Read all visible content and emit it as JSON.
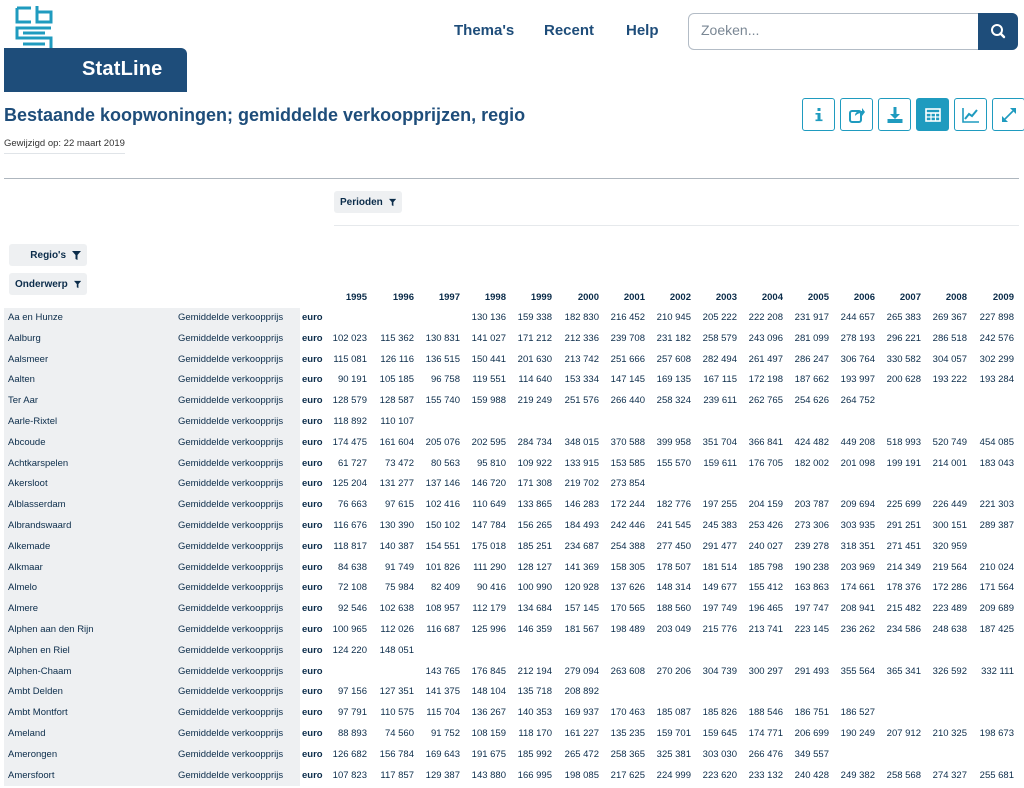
{
  "brand": {
    "name": "StatLine"
  },
  "nav": {
    "items": [
      "Thema's",
      "Recent",
      "Help"
    ]
  },
  "search": {
    "placeholder": "Zoeken..."
  },
  "page": {
    "title": "Bestaande koopwoningen; gemiddelde verkoopprijzen, regio",
    "modified": "Gewijzigd op: 22 maart 2019"
  },
  "toolbar": {
    "buttons": [
      "info-icon",
      "share-icon",
      "download-icon",
      "table-icon",
      "chart-icon",
      "fullscreen-icon"
    ],
    "accent": "#1f9bbf",
    "active": "table-icon"
  },
  "filters": {
    "periods": "Perioden",
    "regions": "Regio's",
    "subject": "Onderwerp"
  },
  "colors": {
    "brand": "#1e4d7a",
    "accent": "#1f9bbf"
  },
  "table": {
    "subject": "Gemiddelde verkoopprijs",
    "unit": "euro",
    "years": [
      "1995",
      "1996",
      "1997",
      "1998",
      "1999",
      "2000",
      "2001",
      "2002",
      "2003",
      "2004",
      "2005",
      "2006",
      "2007",
      "2008",
      "2009"
    ],
    "rows": [
      {
        "region": "Aa en Hunze",
        "values": [
          "",
          "",
          "",
          "130 136",
          "159 338",
          "182 830",
          "216 452",
          "210 945",
          "205 222",
          "222 208",
          "231 917",
          "244 657",
          "265 383",
          "269 367",
          "227 898"
        ]
      },
      {
        "region": "Aalburg",
        "values": [
          "102 023",
          "115 362",
          "130 831",
          "141 027",
          "171 212",
          "212 336",
          "239 708",
          "231 182",
          "258 579",
          "243 096",
          "281 099",
          "278 193",
          "296 221",
          "286 518",
          "242 576"
        ]
      },
      {
        "region": "Aalsmeer",
        "values": [
          "115 081",
          "126 116",
          "136 515",
          "150 441",
          "201 630",
          "213 742",
          "251 666",
          "257 608",
          "282 494",
          "261 497",
          "286 247",
          "306 764",
          "330 582",
          "304 057",
          "302 299"
        ]
      },
      {
        "region": "Aalten",
        "values": [
          "90 191",
          "105 185",
          "96 758",
          "119 551",
          "114 640",
          "153 334",
          "147 145",
          "169 135",
          "167 115",
          "172 198",
          "187 662",
          "193 997",
          "200 628",
          "193 222",
          "193 284"
        ]
      },
      {
        "region": "Ter Aar",
        "values": [
          "128 579",
          "128 587",
          "155 740",
          "159 988",
          "219 249",
          "251 576",
          "266 440",
          "258 324",
          "239 611",
          "262 765",
          "254 626",
          "264 752",
          "",
          "",
          ""
        ]
      },
      {
        "region": "Aarle-Rixtel",
        "values": [
          "118 892",
          "110 107",
          "",
          "",
          "",
          "",
          "",
          "",
          "",
          "",
          "",
          "",
          "",
          "",
          ""
        ]
      },
      {
        "region": "Abcoude",
        "values": [
          "174 475",
          "161 604",
          "205 076",
          "202 595",
          "284 734",
          "348 015",
          "370 588",
          "399 958",
          "351 704",
          "366 841",
          "424 482",
          "449 208",
          "518 993",
          "520 749",
          "454 085"
        ]
      },
      {
        "region": "Achtkarspelen",
        "values": [
          "61 727",
          "73 472",
          "80 563",
          "95 810",
          "109 922",
          "133 915",
          "153 585",
          "155 570",
          "159 611",
          "176 705",
          "182 002",
          "201 098",
          "199 191",
          "214 001",
          "183 043"
        ]
      },
      {
        "region": "Akersloot",
        "values": [
          "125 204",
          "131 277",
          "137 146",
          "146 720",
          "171 308",
          "219 702",
          "273 854",
          "",
          "",
          "",
          "",
          "",
          "",
          "",
          ""
        ]
      },
      {
        "region": "Alblasserdam",
        "values": [
          "76 663",
          "97 615",
          "102 416",
          "110 649",
          "133 865",
          "146 283",
          "172 244",
          "182 776",
          "197 255",
          "204 159",
          "203 787",
          "209 694",
          "225 699",
          "226 449",
          "221 303"
        ]
      },
      {
        "region": "Albrandswaard",
        "values": [
          "116 676",
          "130 390",
          "150 102",
          "147 784",
          "156 265",
          "184 493",
          "242 446",
          "241 545",
          "245 383",
          "253 426",
          "273 306",
          "303 935",
          "291 251",
          "300 151",
          "289 387"
        ]
      },
      {
        "region": "Alkemade",
        "values": [
          "118 817",
          "140 387",
          "154 551",
          "175 018",
          "185 251",
          "234 687",
          "254 388",
          "277 450",
          "291 477",
          "240 027",
          "239 278",
          "318 351",
          "271 451",
          "320 959",
          ""
        ]
      },
      {
        "region": "Alkmaar",
        "values": [
          "84 638",
          "91 749",
          "101 826",
          "111 290",
          "128 127",
          "141 369",
          "158 305",
          "178 507",
          "181 514",
          "185 798",
          "190 238",
          "203 969",
          "214 349",
          "219 564",
          "210 024"
        ]
      },
      {
        "region": "Almelo",
        "values": [
          "72 108",
          "75 984",
          "82 409",
          "90 416",
          "100 990",
          "120 928",
          "137 626",
          "148 314",
          "149 677",
          "155 412",
          "163 863",
          "174 661",
          "178 376",
          "172 286",
          "171 564"
        ]
      },
      {
        "region": "Almere",
        "values": [
          "92 546",
          "102 638",
          "108 957",
          "112 179",
          "134 684",
          "157 145",
          "170 565",
          "188 560",
          "197 749",
          "196 465",
          "197 747",
          "208 941",
          "215 482",
          "223 489",
          "209 689"
        ]
      },
      {
        "region": "Alphen aan den Rijn",
        "values": [
          "100 965",
          "112 026",
          "116 687",
          "125 996",
          "146 359",
          "181 567",
          "198 489",
          "203 049",
          "215 776",
          "213 741",
          "223 145",
          "236 262",
          "234 586",
          "248 638",
          "187 425"
        ]
      },
      {
        "region": "Alphen en Riel",
        "values": [
          "124 220",
          "148 051",
          "",
          "",
          "",
          "",
          "",
          "",
          "",
          "",
          "",
          "",
          "",
          "",
          ""
        ]
      },
      {
        "region": "Alphen-Chaam",
        "values": [
          "",
          "",
          "143 765",
          "176 845",
          "212 194",
          "279 094",
          "263 608",
          "270 206",
          "304 739",
          "300 297",
          "291 493",
          "355 564",
          "365 341",
          "326 592",
          "332 111"
        ]
      },
      {
        "region": "Ambt Delden",
        "values": [
          "97 156",
          "127 351",
          "141 375",
          "148 104",
          "135 718",
          "208 892",
          "",
          "",
          "",
          "",
          "",
          "",
          "",
          "",
          ""
        ]
      },
      {
        "region": "Ambt Montfort",
        "values": [
          "97 791",
          "110 575",
          "115 704",
          "136 267",
          "140 353",
          "169 937",
          "170 463",
          "185 087",
          "185 826",
          "188 546",
          "186 751",
          "186 527",
          "",
          "",
          ""
        ]
      },
      {
        "region": "Ameland",
        "values": [
          "88 893",
          "74 560",
          "91 752",
          "108 159",
          "118 170",
          "161 227",
          "135 235",
          "159 701",
          "159 645",
          "174 771",
          "206 699",
          "190 249",
          "207 912",
          "210 325",
          "198 673"
        ]
      },
      {
        "region": "Amerongen",
        "values": [
          "126 682",
          "156 784",
          "169 643",
          "191 675",
          "185 992",
          "265 472",
          "258 365",
          "325 381",
          "303 030",
          "266 476",
          "349 557",
          "",
          "",
          "",
          ""
        ]
      },
      {
        "region": "Amersfoort",
        "values": [
          "107 823",
          "117 857",
          "129 387",
          "143 880",
          "166 995",
          "198 085",
          "217 625",
          "224 999",
          "223 620",
          "233 132",
          "240 428",
          "249 382",
          "258 568",
          "274 327",
          "255 681"
        ]
      }
    ]
  }
}
